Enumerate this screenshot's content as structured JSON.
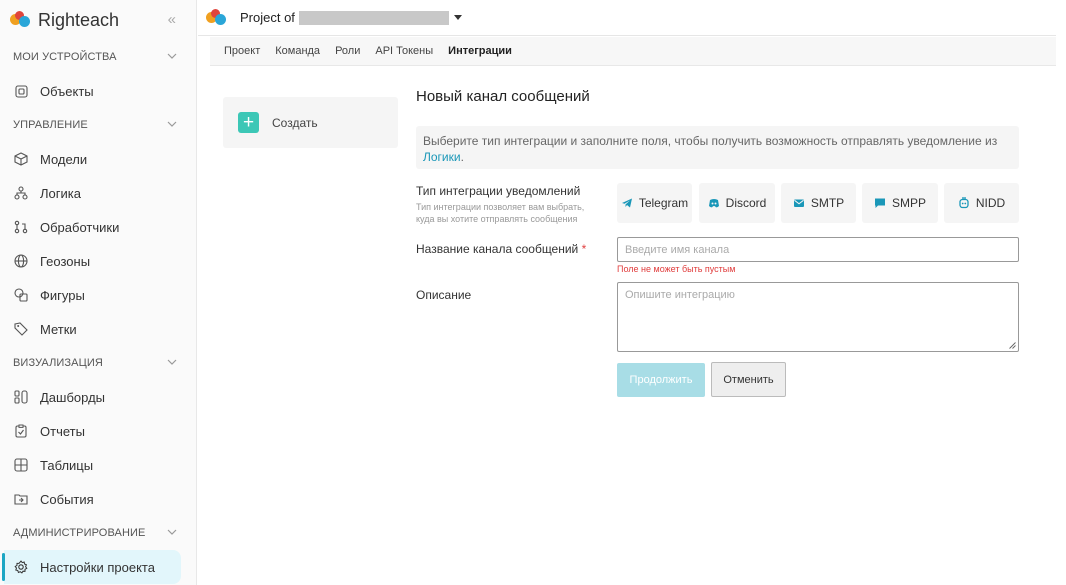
{
  "brand": {
    "name": "Righteach",
    "collapse_icon": "double-chevron-left-icon"
  },
  "topbar": {
    "project_label": "Project of"
  },
  "sidebar": {
    "sections": [
      {
        "title": "МОИ УСТРОЙСТВА",
        "items": [
          {
            "label": "Объекты",
            "icon": "object-icon"
          }
        ]
      },
      {
        "title": "УПРАВЛЕНИЕ",
        "items": [
          {
            "label": "Модели",
            "icon": "cube-icon"
          },
          {
            "label": "Логика",
            "icon": "logic-icon"
          },
          {
            "label": "Обработчики",
            "icon": "handlers-icon"
          },
          {
            "label": "Геозоны",
            "icon": "globe-icon"
          },
          {
            "label": "Фигуры",
            "icon": "shapes-icon"
          },
          {
            "label": "Метки",
            "icon": "tag-icon"
          }
        ]
      },
      {
        "title": "ВИЗУАЛИЗАЦИЯ",
        "items": [
          {
            "label": "Дашборды",
            "icon": "dashboard-icon"
          },
          {
            "label": "Отчеты",
            "icon": "report-icon"
          },
          {
            "label": "Таблицы",
            "icon": "table-icon"
          },
          {
            "label": "События",
            "icon": "events-icon"
          }
        ]
      },
      {
        "title": "АДМИНИСТРИРОВАНИЕ",
        "items": [
          {
            "label": "Настройки проекта",
            "icon": "gear-icon",
            "active": true
          }
        ]
      }
    ]
  },
  "tabs": [
    "Проект",
    "Команда",
    "Роли",
    "API Токены",
    "Интеграции"
  ],
  "active_tab": "Интеграции",
  "left_panel": {
    "create_label": "Создать"
  },
  "form": {
    "title": "Новый канал сообщений",
    "info_text": "Выберите тип интеграции и заполните поля, чтобы получить возможность отправлять уведомление из",
    "info_link": "Логики",
    "info_end": ".",
    "type_label": "Тип интеграции уведомлений",
    "type_hint_1": "Тип интеграции позволяет вам выбрать,",
    "type_hint_2": "куда вы хотите отправлять сообщения",
    "integrations": [
      "Telegram",
      "Discord",
      "SMTP",
      "SMPP",
      "NIDD"
    ],
    "name_label": "Название канала сообщений",
    "required_mark": "*",
    "name_placeholder": "Введите имя канала",
    "name_error": "Поле не может быть пустым",
    "description_label": "Описание",
    "description_placeholder": "Опишите интеграцию",
    "continue_label": "Продолжить",
    "cancel_label": "Отменить"
  },
  "colors": {
    "accent": "#1aa6c4",
    "create": "#3cc7b6",
    "error": "#e03c3c",
    "continue_disabled": "#a8dde6"
  }
}
